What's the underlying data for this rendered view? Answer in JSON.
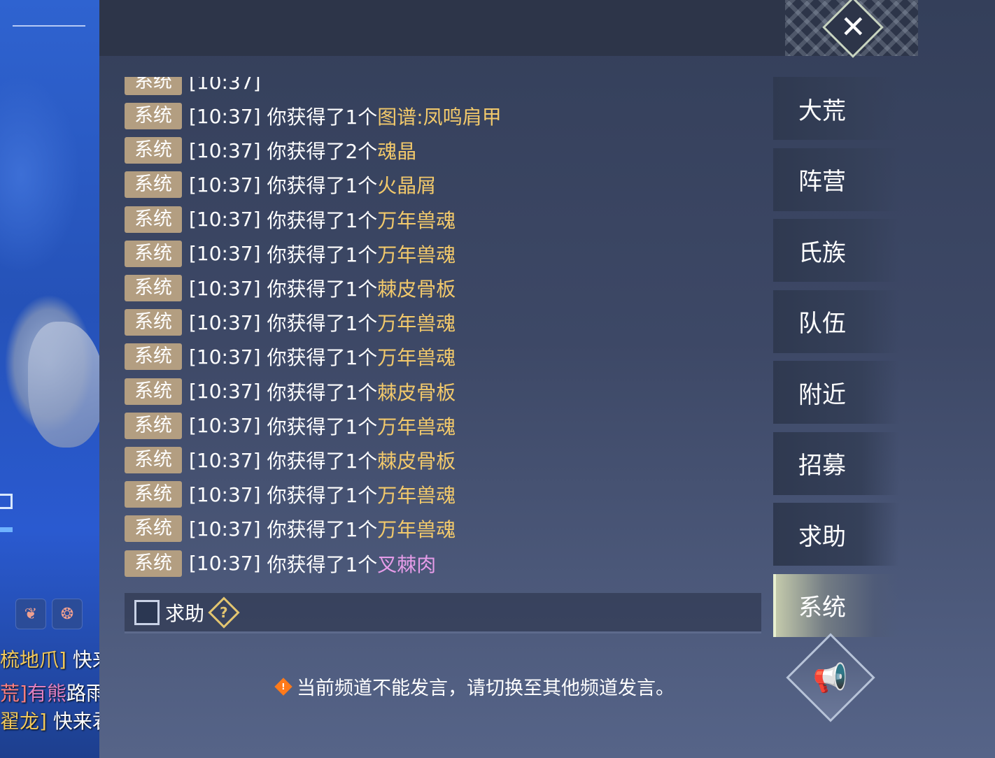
{
  "scene": {
    "chat_lines": [
      {
        "prefix": "梳地爪]",
        "text": " 快来"
      },
      {
        "prefix": "荒]",
        "name": "有熊",
        "text": "路雨"
      },
      {
        "prefix": "翟龙]",
        "text": " 快来君"
      }
    ],
    "icons": [
      "lungs-icon",
      "beast-icon"
    ]
  },
  "close_button": {
    "symbol": "✕"
  },
  "messages": [
    {
      "tag": "系统",
      "time": "[10:37]",
      "text": "你获得了1个",
      "item": "图谱:凤鸣肩甲",
      "rarity": "gold"
    },
    {
      "tag": "系统",
      "time": "[10:37]",
      "text": "你获得了2个",
      "item": "魂晶",
      "rarity": "gold"
    },
    {
      "tag": "系统",
      "time": "[10:37]",
      "text": "你获得了1个",
      "item": "火晶屑",
      "rarity": "gold"
    },
    {
      "tag": "系统",
      "time": "[10:37]",
      "text": "你获得了1个",
      "item": "万年兽魂",
      "rarity": "gold"
    },
    {
      "tag": "系统",
      "time": "[10:37]",
      "text": "你获得了1个",
      "item": "万年兽魂",
      "rarity": "gold"
    },
    {
      "tag": "系统",
      "time": "[10:37]",
      "text": "你获得了1个",
      "item": "棘皮骨板",
      "rarity": "gold"
    },
    {
      "tag": "系统",
      "time": "[10:37]",
      "text": "你获得了1个",
      "item": "万年兽魂",
      "rarity": "gold"
    },
    {
      "tag": "系统",
      "time": "[10:37]",
      "text": "你获得了1个",
      "item": "万年兽魂",
      "rarity": "gold"
    },
    {
      "tag": "系统",
      "time": "[10:37]",
      "text": "你获得了1个",
      "item": "棘皮骨板",
      "rarity": "gold"
    },
    {
      "tag": "系统",
      "time": "[10:37]",
      "text": "你获得了1个",
      "item": "万年兽魂",
      "rarity": "gold"
    },
    {
      "tag": "系统",
      "time": "[10:37]",
      "text": "你获得了1个",
      "item": "棘皮骨板",
      "rarity": "gold"
    },
    {
      "tag": "系统",
      "time": "[10:37]",
      "text": "你获得了1个",
      "item": "万年兽魂",
      "rarity": "gold"
    },
    {
      "tag": "系统",
      "time": "[10:37]",
      "text": "你获得了1个",
      "item": "万年兽魂",
      "rarity": "gold"
    },
    {
      "tag": "系统",
      "time": "[10:37]",
      "text": "你获得了1个",
      "item": "叉棘肉",
      "rarity": "pink"
    }
  ],
  "help_row": {
    "label": "求助",
    "icon_symbol": "?"
  },
  "notice": {
    "icon_symbol": "!",
    "text": "当前频道不能发言，请切换至其他频道发言。"
  },
  "tabs": [
    "大荒",
    "阵营",
    "氏族",
    "队伍",
    "附近",
    "招募",
    "求助",
    "系统"
  ],
  "active_tab": "系统",
  "horn_button": {
    "icon": "megaphone-icon",
    "symbol": "📢"
  },
  "colors": {
    "tag_bg": "#b39e81",
    "item_gold": "#f2c96b",
    "item_pink": "#e59ce8",
    "panel_bg": "#3d4866"
  }
}
